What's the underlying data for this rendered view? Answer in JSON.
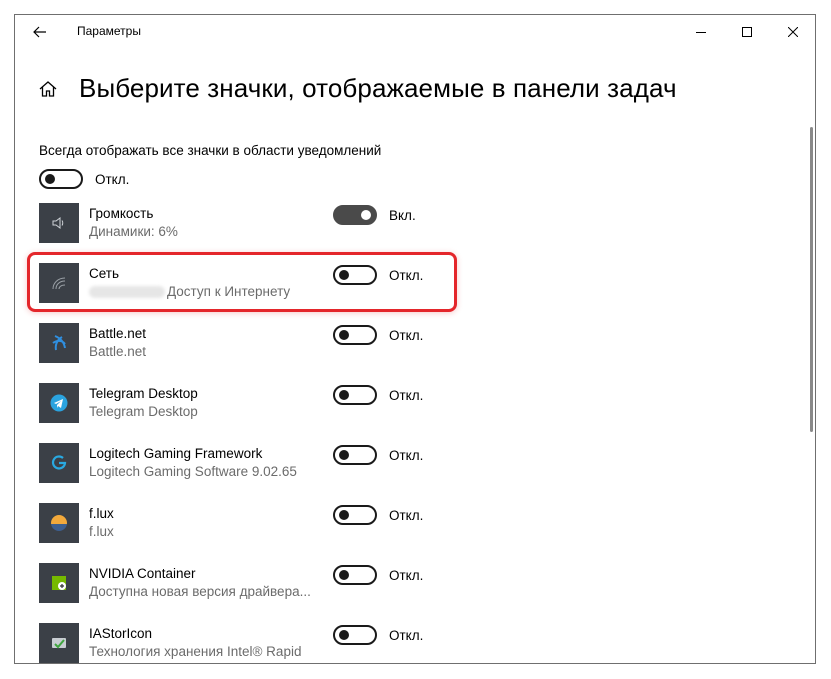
{
  "window": {
    "title": "Параметры"
  },
  "page": {
    "title": "Выберите значки, отображаемые в панели задач"
  },
  "always_show": {
    "label": "Всегда отображать все значки в области уведомлений",
    "state_label": "Откл.",
    "on": false
  },
  "apps": [
    {
      "name": "Громкость",
      "subtitle": "Динамики: 6%",
      "on": true,
      "state_label": "Вкл.",
      "icon": "speaker-icon"
    },
    {
      "name": "Сеть",
      "subtitle": "Доступ к Интернету",
      "on": false,
      "state_label": "Откл.",
      "icon": "wifi-icon"
    },
    {
      "name": "Battle.net",
      "subtitle": "Battle.net",
      "on": false,
      "state_label": "Откл.",
      "icon": "battlenet-icon"
    },
    {
      "name": "Telegram Desktop",
      "subtitle": "Telegram Desktop",
      "on": false,
      "state_label": "Откл.",
      "icon": "telegram-icon"
    },
    {
      "name": "Logitech Gaming Framework",
      "subtitle": "Logitech Gaming Software 9.02.65",
      "on": false,
      "state_label": "Откл.",
      "icon": "logitech-icon"
    },
    {
      "name": "f.lux",
      "subtitle": "f.lux",
      "on": false,
      "state_label": "Откл.",
      "icon": "flux-icon"
    },
    {
      "name": "NVIDIA Container",
      "subtitle": "Доступна новая версия драйвера...",
      "on": false,
      "state_label": "Откл.",
      "icon": "nvidia-icon"
    },
    {
      "name": "IAStorIcon",
      "subtitle": "Технология хранения Intel® Rapid",
      "on": false,
      "state_label": "Откл.",
      "icon": "intel-storage-icon"
    }
  ],
  "colors": {
    "highlight": "#e4262b",
    "icon_bg": "#3b4047",
    "toggle_on": "#4a4a4a"
  }
}
